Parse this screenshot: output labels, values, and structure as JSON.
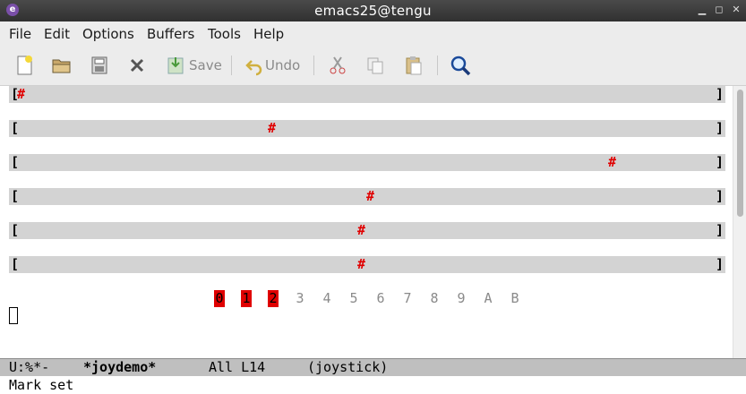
{
  "window": {
    "title": "emacs25@tengu"
  },
  "menubar": {
    "items": [
      "File",
      "Edit",
      "Options",
      "Buffers",
      "Tools",
      "Help"
    ]
  },
  "toolbar": {
    "save_label": "Save",
    "undo_label": "Undo",
    "icons": [
      "new-file-icon",
      "open-folder-icon",
      "save-disk-icon",
      "close-icon",
      "save-icon",
      "undo-icon",
      "cut-icon",
      "copy-icon",
      "paste-icon",
      "search-icon"
    ]
  },
  "buffer": {
    "rows": [
      {
        "left": "[",
        "hash": "#",
        "right": "]"
      },
      {
        "left": "[",
        "hash": "#",
        "right": "]"
      },
      {
        "left": "[",
        "hash": "#",
        "right": "]"
      },
      {
        "left": "[",
        "hash": "#",
        "right": "]"
      },
      {
        "left": "[",
        "hash": "#",
        "right": "]"
      },
      {
        "left": "[",
        "hash": "#",
        "right": "]"
      }
    ],
    "buttons": [
      {
        "label": "0",
        "pressed": true
      },
      {
        "label": "1",
        "pressed": true
      },
      {
        "label": "2",
        "pressed": true
      },
      {
        "label": "3",
        "pressed": false
      },
      {
        "label": "4",
        "pressed": false
      },
      {
        "label": "5",
        "pressed": false
      },
      {
        "label": "6",
        "pressed": false
      },
      {
        "label": "7",
        "pressed": false
      },
      {
        "label": "8",
        "pressed": false
      },
      {
        "label": "9",
        "pressed": false
      },
      {
        "label": "A",
        "pressed": false
      },
      {
        "label": "B",
        "pressed": false
      }
    ]
  },
  "modeline": {
    "status": "U:%*-",
    "buffer_name": "*joydemo*",
    "position": "All L14",
    "mode": "(joystick)"
  },
  "minibuffer": {
    "message": "Mark set"
  },
  "colors": {
    "hash": "#e00000",
    "track": "#d3d3d3",
    "pressed": "#e00000"
  }
}
